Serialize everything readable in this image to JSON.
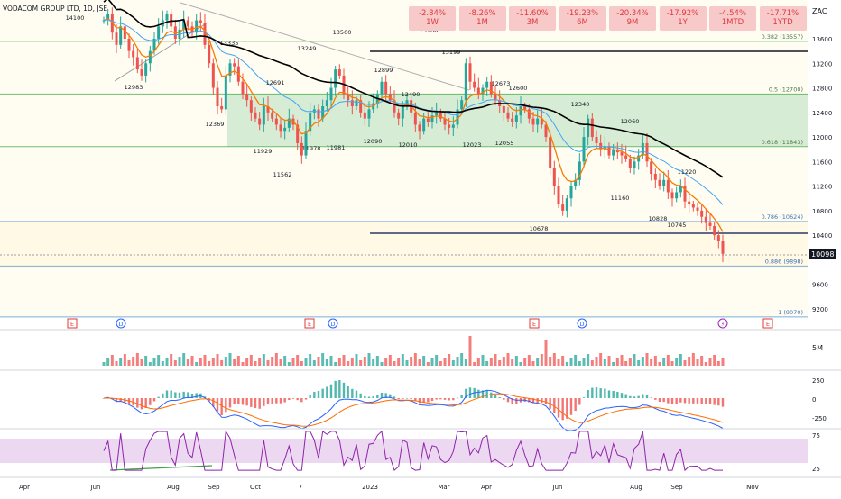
{
  "header": {
    "title": "VODACOM GROUP LTD, 1D, JSE",
    "currency": "ZAC",
    "interval_badge": "1D"
  },
  "performance": [
    {
      "value": "-2.84%",
      "period": "1W"
    },
    {
      "value": "-8.26%",
      "period": "1M"
    },
    {
      "value": "-11.60%",
      "period": "3M"
    },
    {
      "value": "-19.23%",
      "period": "6M"
    },
    {
      "value": "-20.34%",
      "period": "9M"
    },
    {
      "value": "-17.92%",
      "period": "1Y"
    },
    {
      "value": "-4.54%",
      "period": "1MTD"
    },
    {
      "value": "-17.71%",
      "period": "1YTD"
    }
  ],
  "last_price": "10098",
  "price_axis": [
    "13600",
    "13200",
    "12800",
    "12400",
    "12000",
    "11600",
    "11200",
    "10800",
    "10400",
    "9600",
    "9200"
  ],
  "fib_labels": [
    {
      "text": "0.382 (13557)",
      "price": 13557
    },
    {
      "text": "0.5 (12700)",
      "price": 12700
    },
    {
      "text": "0.618 (11843)",
      "price": 11843
    },
    {
      "text": "0.786 (10624)",
      "price": 10624
    },
    {
      "text": "0.886 (9898)",
      "price": 9898
    },
    {
      "text": "1 (9070)",
      "price": 9070
    }
  ],
  "swing_labels": [
    "14100",
    "12983",
    "13335",
    "12369",
    "13249",
    "13500",
    "12691",
    "11929",
    "11562",
    "11978",
    "11981",
    "12899",
    "12090",
    "12490",
    "12010",
    "13708",
    "13199",
    "12673",
    "12600",
    "12023",
    "12055",
    "12340",
    "12060",
    "11160",
    "10678",
    "11220",
    "10828",
    "10745"
  ],
  "time_axis": [
    "Apr",
    "Jun",
    "Aug",
    "Sep",
    "Oct",
    "7",
    "2023",
    "Mar",
    "Apr",
    "Jun",
    "Aug",
    "Sep",
    "Nov"
  ],
  "events": [
    "E",
    "D",
    "E",
    "D",
    "E",
    "D",
    "⚡",
    "E"
  ],
  "volume_axis": [
    "5M"
  ],
  "macd_axis": [
    "250",
    "0",
    "-250"
  ],
  "rsi_axis": [
    "75",
    "25"
  ],
  "colors": {
    "up": "#26a69a",
    "down": "#ef5350",
    "ema_fast": "#f57c00",
    "ema_mid": "#42a5f5",
    "sma_slow": "#000000",
    "fib_green": "#4caf50",
    "fib_blue": "#5b9bd5",
    "rsi_band": "#e1bee7"
  },
  "chart_data": {
    "type": "candlestick",
    "title": "VODACOM GROUP LTD, 1D, JSE",
    "ylim": [
      8850,
      14200
    ],
    "closes": [
      13900,
      14000,
      13700,
      13500,
      13800,
      13600,
      13400,
      13300,
      13100,
      13000,
      13200,
      13400,
      13600,
      13800,
      13900,
      14000,
      13800,
      13600,
      13750,
      13900,
      13800,
      13700,
      13900,
      13850,
      13500,
      13200,
      12800,
      12500,
      12450,
      13000,
      13200,
      13150,
      12900,
      12700,
      12600,
      12400,
      12300,
      12200,
      12500,
      12400,
      12300,
      12200,
      12100,
      12150,
      12300,
      12200,
      11900,
      11700,
      12100,
      12400,
      12450,
      12300,
      12500,
      12600,
      12800,
      13100,
      13000,
      12700,
      12600,
      12500,
      12600,
      12400,
      12300,
      12450,
      12550,
      12700,
      12900,
      12700,
      12600,
      12400,
      12300,
      12500,
      12600,
      12400,
      12200,
      12100,
      12300,
      12250,
      12350,
      12400,
      12300,
      12200,
      12150,
      12200,
      12450,
      12600,
      13200,
      12900,
      12800,
      12700,
      12800,
      12900,
      12700,
      12600,
      12500,
      12400,
      12300,
      12250,
      12350,
      12500,
      12450,
      12300,
      12200,
      12300,
      12200,
      12000,
      11500,
      11200,
      10900,
      10800,
      11000,
      11200,
      11300,
      11600,
      12000,
      12300,
      12000,
      11900,
      11800,
      11850,
      11700,
      11800,
      11750,
      11700,
      11650,
      11500,
      11600,
      11700,
      11900,
      11600,
      11400,
      11300,
      11200,
      11300,
      11100,
      11000,
      11100,
      11200,
      10950,
      10900,
      10850,
      10800,
      10700,
      10600,
      10550,
      10400,
      10300,
      10098
    ]
  }
}
